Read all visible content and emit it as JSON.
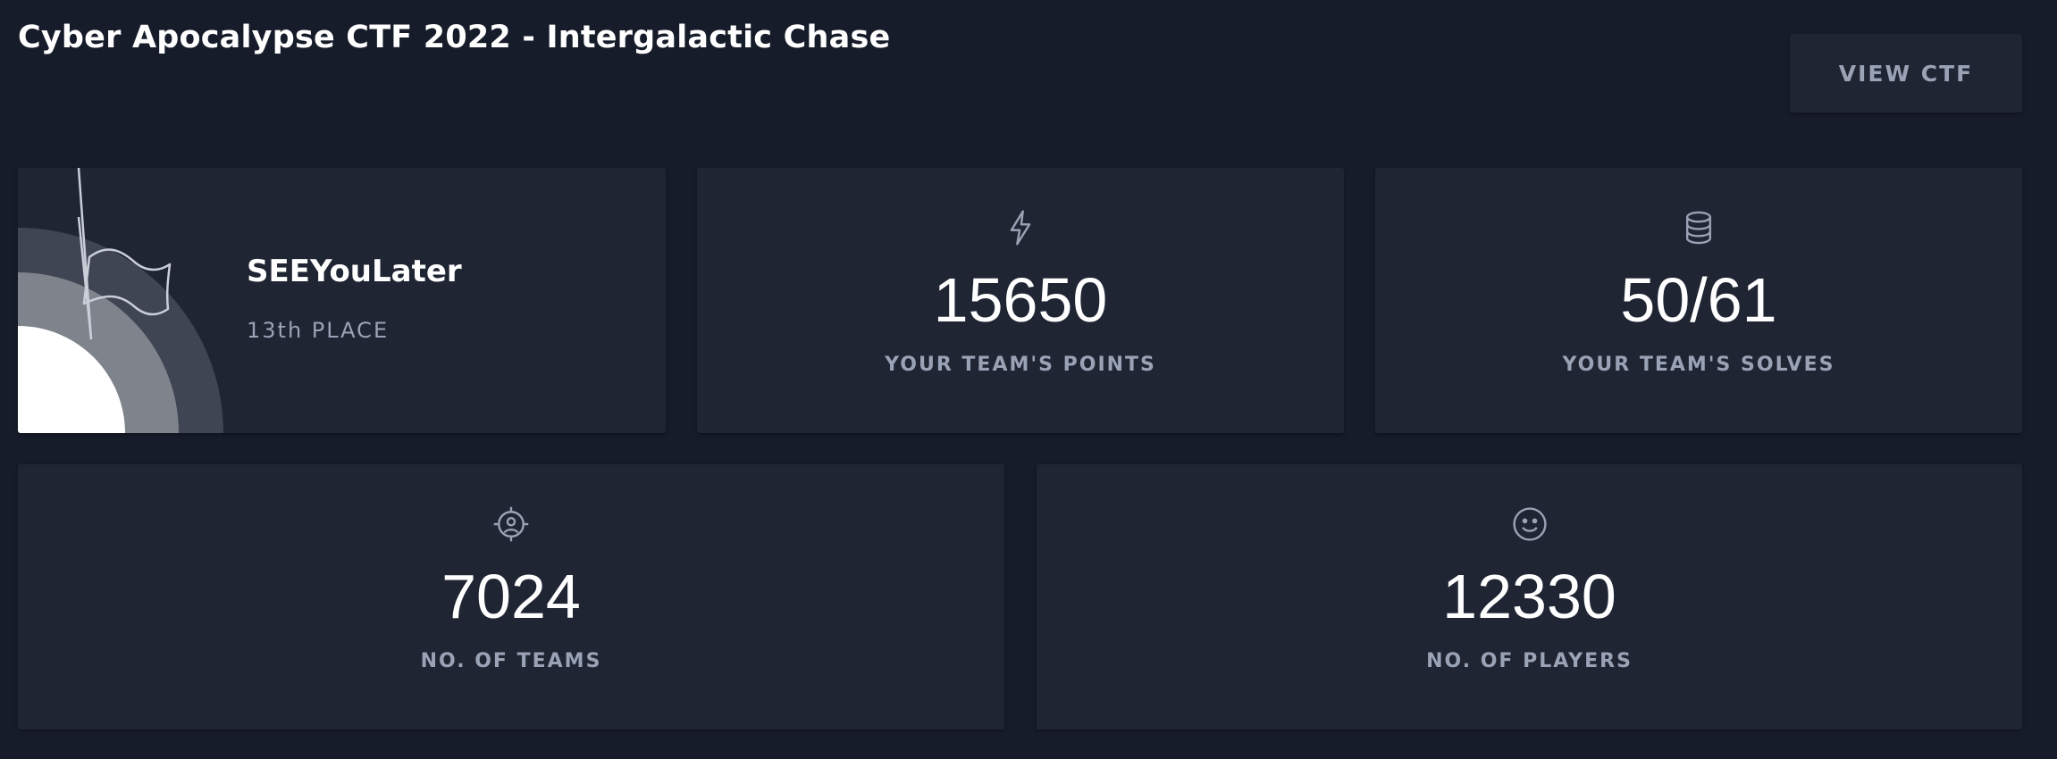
{
  "header": {
    "title": "Cyber Apocalypse CTF 2022 - Intergalactic Chase",
    "view_button_label": "VIEW CTF"
  },
  "team_card": {
    "team_name": "SEEYouLater",
    "place": "13th PLACE",
    "icon": "flag-icon"
  },
  "stats": {
    "points": {
      "value": "15650",
      "label": "YOUR TEAM'S POINTS",
      "icon": "lightning-icon"
    },
    "solves": {
      "value": "50/61",
      "label": "YOUR TEAM'S SOLVES",
      "icon": "database-icon"
    },
    "teams": {
      "value": "7024",
      "label": "NO. OF TEAMS",
      "icon": "target-user-icon"
    },
    "players": {
      "value": "12330",
      "label": "NO. OF PLAYERS",
      "icon": "smiley-icon"
    }
  },
  "colors": {
    "background": "#161c2a",
    "card": "#1f2533",
    "text": "#ffffff",
    "muted": "#9aa3b6"
  }
}
